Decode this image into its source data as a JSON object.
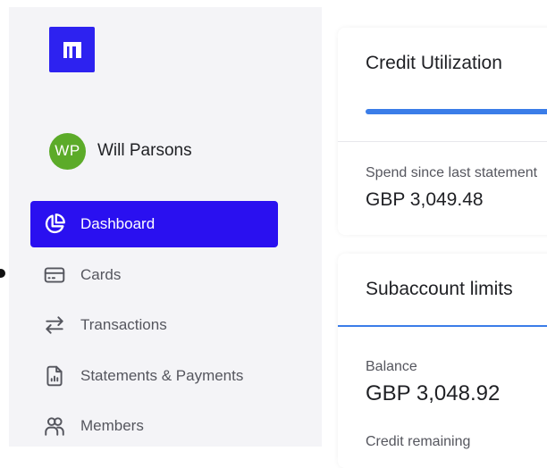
{
  "brand": {
    "logo_icon": "brand-logo-icon",
    "accent": "#2a10f0"
  },
  "user": {
    "initials": "WP",
    "name": "Will Parsons",
    "avatar_color": "#5cab29"
  },
  "nav": {
    "items": [
      {
        "label": "Dashboard",
        "icon": "pie-chart-icon",
        "active": true
      },
      {
        "label": "Cards",
        "icon": "credit-card-icon"
      },
      {
        "label": "Transactions",
        "icon": "arrows-exchange-icon"
      },
      {
        "label": "Statements & Payments",
        "icon": "document-chart-icon"
      },
      {
        "label": "Members",
        "icon": "users-icon"
      }
    ]
  },
  "credit_utilization": {
    "title": "Credit Utilization",
    "utilization_bar_color": "#3b7de8",
    "spend_label": "Spend since last statement",
    "spend_value": "GBP 3,049.48"
  },
  "subaccount_limits": {
    "title": "Subaccount limits",
    "balance_label": "Balance",
    "balance_value": "GBP 3,048.92",
    "credit_remaining_label": "Credit remaining"
  }
}
